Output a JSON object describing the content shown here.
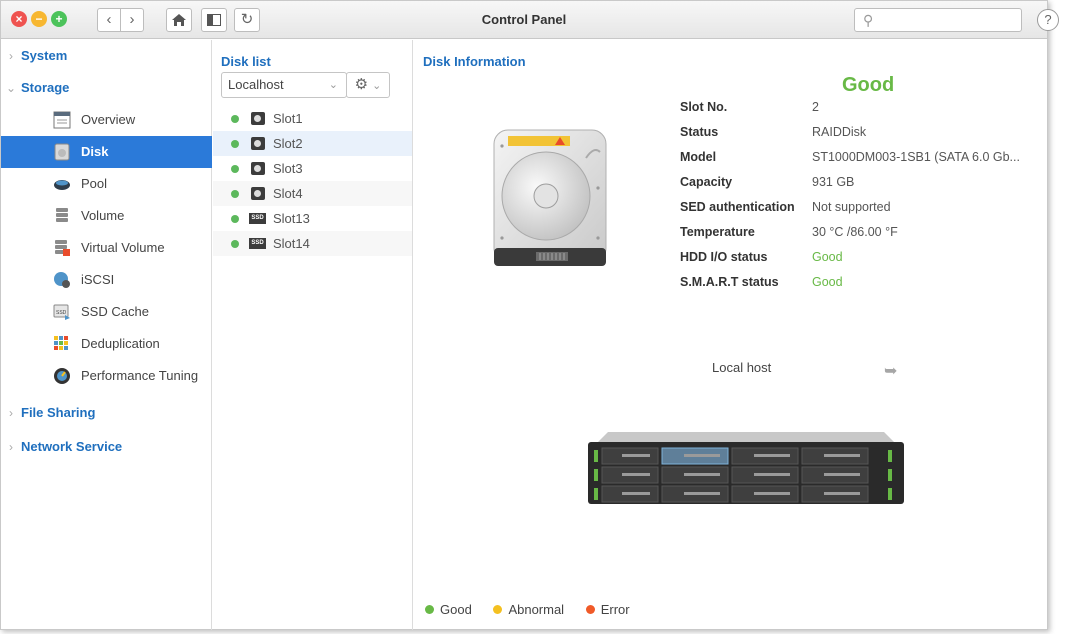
{
  "titlebar": {
    "title": "Control Panel",
    "search_placeholder": "",
    "help_label": "?"
  },
  "sidebar": {
    "groups": {
      "system": "System",
      "storage": "Storage",
      "file_sharing": "File Sharing",
      "network_service": "Network Service"
    },
    "items": [
      {
        "label": "Overview",
        "icon": "overview-icon"
      },
      {
        "label": "Disk",
        "icon": "disk-icon",
        "active": true
      },
      {
        "label": "Pool",
        "icon": "pool-icon"
      },
      {
        "label": "Volume",
        "icon": "volume-icon"
      },
      {
        "label": "Virtual Volume",
        "icon": "virtual-volume-icon"
      },
      {
        "label": "iSCSI",
        "icon": "iscsi-icon"
      },
      {
        "label": "SSD Cache",
        "icon": "ssd-cache-icon"
      },
      {
        "label": "Deduplication",
        "icon": "deduplication-icon"
      },
      {
        "label": "Performance Tuning",
        "icon": "performance-tuning-icon"
      }
    ]
  },
  "disk_list": {
    "title": "Disk list",
    "host_select": "Localhost",
    "slots": [
      {
        "label": "Slot1",
        "type": "hdd",
        "status": "good"
      },
      {
        "label": "Slot2",
        "type": "hdd",
        "status": "good",
        "selected": true
      },
      {
        "label": "Slot3",
        "type": "hdd",
        "status": "good"
      },
      {
        "label": "Slot4",
        "type": "hdd",
        "status": "good"
      },
      {
        "label": "Slot13",
        "type": "ssd",
        "status": "good"
      },
      {
        "label": "Slot14",
        "type": "ssd",
        "status": "good"
      }
    ],
    "ssd_badge": "SSD"
  },
  "disk_info": {
    "title": "Disk Information",
    "overall_status": "Good",
    "properties": [
      {
        "label": "Slot No.",
        "value": "2"
      },
      {
        "label": "Status",
        "value": "RAIDDisk"
      },
      {
        "label": "Model",
        "value": "ST1000DM003-1SB1 (SATA 6.0 Gb..."
      },
      {
        "label": "Capacity",
        "value": "931 GB"
      },
      {
        "label": "SED authentication",
        "value": "Not supported"
      },
      {
        "label": "Temperature",
        "value": "30 °C /86.00 °F"
      },
      {
        "label": "HDD I/O status",
        "value": "Good"
      },
      {
        "label": "S.M.A.R.T status",
        "value": "Good"
      }
    ],
    "local_host_label": "Local host"
  },
  "legend": {
    "good": "Good",
    "abnormal": "Abnormal",
    "error": "Error"
  },
  "colors": {
    "accent": "#2b7ad9",
    "link_blue": "#1f6fbe",
    "good": "#68b946",
    "abnormal": "#f4c020",
    "error": "#f05a28"
  }
}
